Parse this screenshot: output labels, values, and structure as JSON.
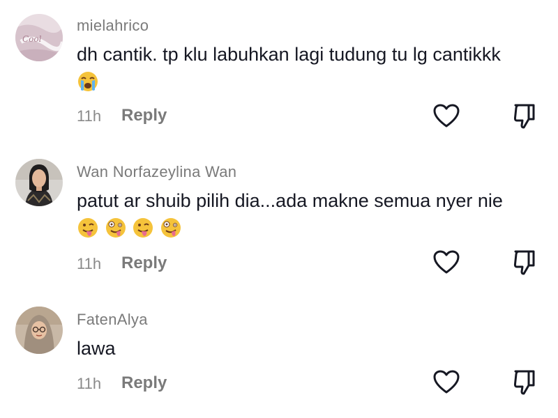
{
  "comments": [
    {
      "username": "mielahrico",
      "text": "dh cantik. tp klu labuhkan lagi tudung tu lg cantikkk",
      "emojis": [
        "loudly-crying-face"
      ],
      "time": "11h",
      "reply_label": "Reply",
      "avatar_icon": "avatar-photo-pink"
    },
    {
      "username": "Wan Norfazeylina Wan",
      "text": "patut ar shuib pilih dia...ada makne semua nyer nie",
      "emojis": [
        "winking-face-with-tongue",
        "zany-face",
        "winking-face-with-tongue",
        "zany-face"
      ],
      "time": "11h",
      "reply_label": "Reply",
      "avatar_icon": "avatar-photo-woman"
    },
    {
      "username": "FatenAlya",
      "text": "lawa",
      "emojis": [],
      "time": "11h",
      "reply_label": "Reply",
      "avatar_icon": "avatar-photo-hijab"
    }
  ],
  "icons": {
    "like": "heart-outline-icon",
    "dislike": "thumbs-down-outline-icon"
  },
  "colors": {
    "text": "#161823",
    "meta": "#8a8a8a",
    "emoji": "#F5C33B"
  }
}
